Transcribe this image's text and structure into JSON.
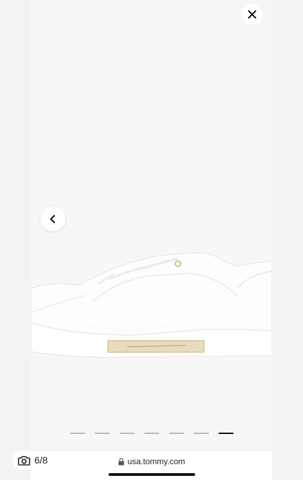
{
  "viewer": {
    "counter_text": "6/8",
    "pager": {
      "total": 7,
      "active_index": 6
    }
  },
  "icons": {
    "close": "close-icon",
    "prev": "chevron-left-icon",
    "camera": "camera-icon",
    "lock": "lock-icon"
  },
  "browser": {
    "url": "usa.tommy.com"
  },
  "colors": {
    "active_indicator": "#111111",
    "inactive_indicator": "#b9b9bd",
    "shoe_accent": "#c9b27a"
  }
}
